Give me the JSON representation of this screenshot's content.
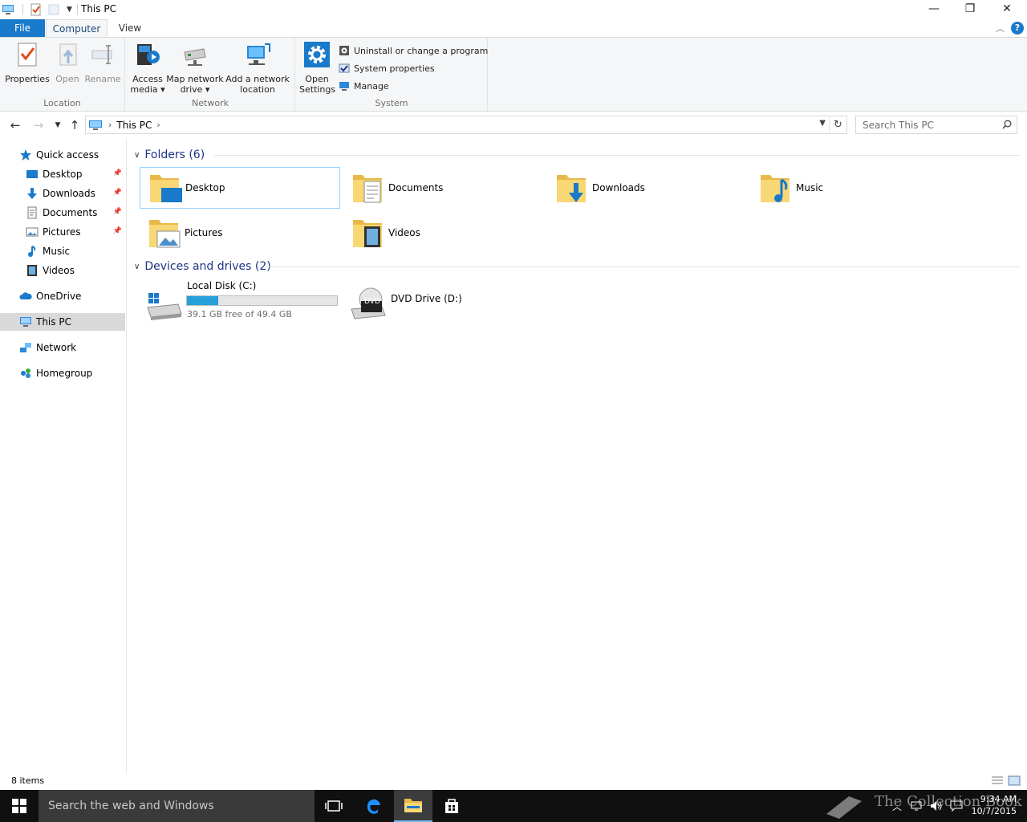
{
  "window": {
    "title": "This PC",
    "minimize_glyph": "—",
    "restore_glyph": "❐",
    "close_glyph": "✕"
  },
  "ribbon": {
    "tabs": {
      "file": "File",
      "computer": "Computer",
      "view": "View"
    },
    "groups": {
      "location": "Location",
      "network": "Network",
      "system": "System"
    },
    "buttons": {
      "properties": "Properties",
      "open": "Open",
      "rename": "Rename",
      "access_media_1": "Access",
      "access_media_2": "media ▾",
      "map_drive_1": "Map network",
      "map_drive_2": "drive ▾",
      "add_location_1": "Add a network",
      "add_location_2": "location",
      "open_settings_1": "Open",
      "open_settings_2": "Settings",
      "uninstall": "Uninstall or change a program",
      "system_properties": "System properties",
      "manage": "Manage"
    },
    "help": "?"
  },
  "address_bar": {
    "crumb": "This PC",
    "search_placeholder": "Search This PC"
  },
  "nav_pane": {
    "items": [
      {
        "label": "Quick access",
        "icon": "star-icon"
      },
      {
        "label": "Desktop",
        "icon": "desktop-icon",
        "pinned": true
      },
      {
        "label": "Downloads",
        "icon": "download-arrow-icon",
        "pinned": true
      },
      {
        "label": "Documents",
        "icon": "documents-icon",
        "pinned": true
      },
      {
        "label": "Pictures",
        "icon": "pictures-icon",
        "pinned": true
      },
      {
        "label": "Music",
        "icon": "music-note-icon"
      },
      {
        "label": "Videos",
        "icon": "videos-icon"
      },
      {
        "label": "OneDrive",
        "icon": "cloud-icon"
      },
      {
        "label": "This PC",
        "icon": "computer-icon",
        "selected": true
      },
      {
        "label": "Network",
        "icon": "network-icon"
      },
      {
        "label": "Homegroup",
        "icon": "homegroup-icon"
      }
    ]
  },
  "content": {
    "folders_header": "Folders (6)",
    "folders": [
      {
        "label": "Desktop",
        "icon": "desktop-folder-icon",
        "selected": true
      },
      {
        "label": "Documents",
        "icon": "documents-folder-icon"
      },
      {
        "label": "Downloads",
        "icon": "downloads-folder-icon"
      },
      {
        "label": "Music",
        "icon": "music-folder-icon"
      },
      {
        "label": "Pictures",
        "icon": "pictures-folder-icon"
      },
      {
        "label": "Videos",
        "icon": "videos-folder-icon"
      }
    ],
    "drives_header": "Devices and drives (2)",
    "drives": [
      {
        "label": "Local Disk (C:)",
        "free_text": "39.1 GB free of 49.4 GB",
        "used_fraction": 0.21,
        "icon": "windows-drive-icon"
      },
      {
        "label": "DVD Drive (D:)",
        "icon": "dvd-drive-icon",
        "badge": "DVD"
      }
    ]
  },
  "status": {
    "item_count": "8 items"
  },
  "taskbar": {
    "search_placeholder": "Search the web and Windows",
    "time": "9:34 AM",
    "date": "10/7/2015",
    "watermark": "The Collection Book"
  },
  "colors": {
    "accent": "#1979ca",
    "folder_yellow": "#f8d775",
    "header_blue": "#1e3287",
    "drive_fill": "#26a0da",
    "taskbar": "#101010"
  }
}
